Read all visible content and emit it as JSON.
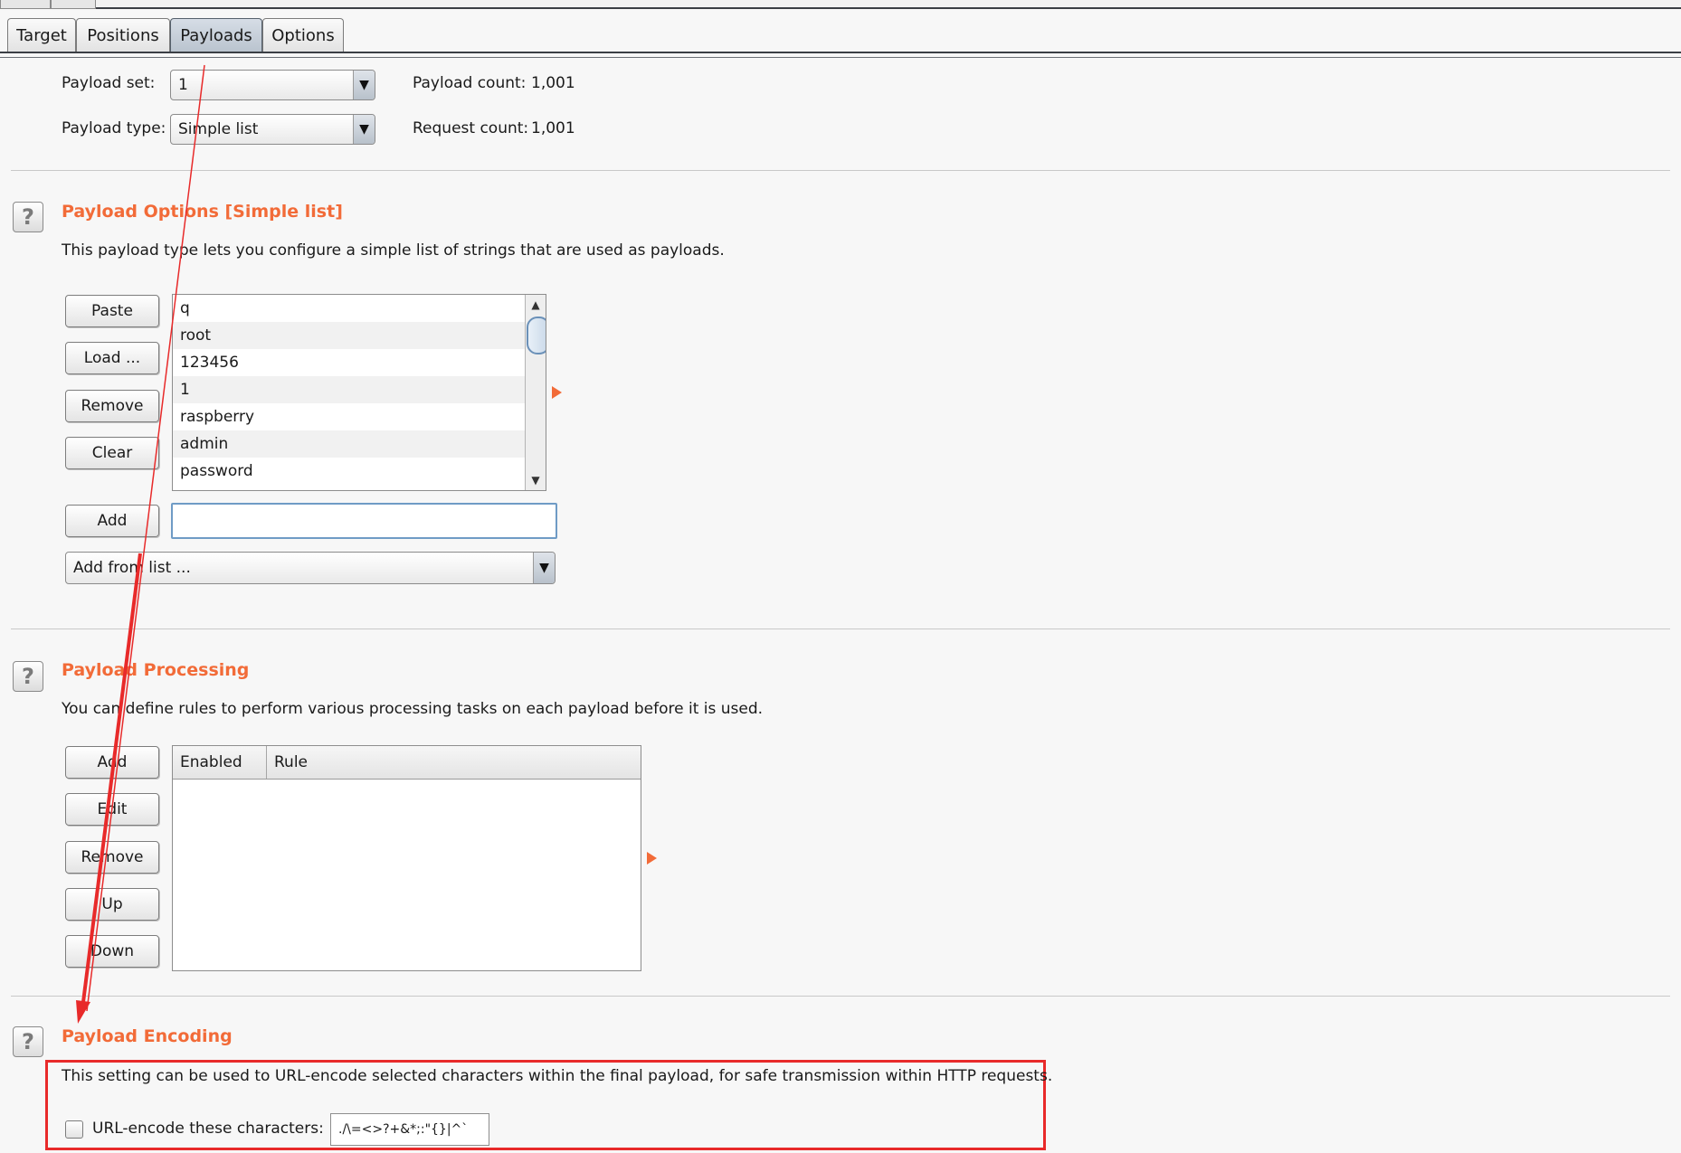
{
  "tabs": [
    {
      "label": "Target"
    },
    {
      "label": "Positions"
    },
    {
      "label": "Payloads",
      "active": true
    },
    {
      "label": "Options"
    }
  ],
  "payload_set": {
    "label": "Payload set:",
    "value": "1"
  },
  "payload_type": {
    "label": "Payload type:",
    "value": "Simple list"
  },
  "payload_count": {
    "label": "Payload count:",
    "value": "1,001"
  },
  "request_count": {
    "label": "Request count:",
    "value": "1,001"
  },
  "options_section": {
    "title": "Payload Options [Simple list]",
    "description": "This payload type lets you configure a simple list of strings that are used as payloads.",
    "buttons": {
      "paste": "Paste",
      "load": "Load ...",
      "remove": "Remove",
      "clear": "Clear",
      "add": "Add"
    },
    "items": [
      "q",
      "root",
      "123456",
      "1",
      "raspberry",
      "admin",
      "password"
    ],
    "add_input_value": "",
    "add_from_list": "Add from list ..."
  },
  "processing_section": {
    "title": "Payload Processing",
    "description": "You can define rules to perform various processing tasks on each payload before it is used.",
    "buttons": {
      "add": "Add",
      "edit": "Edit",
      "remove": "Remove",
      "up": "Up",
      "down": "Down"
    },
    "columns": [
      "Enabled",
      "Rule"
    ]
  },
  "encoding_section": {
    "title": "Payload Encoding",
    "description": "This setting can be used to URL-encode selected characters within the final payload, for safe transmission within HTTP requests.",
    "checkbox_label": "URL-encode these characters:",
    "checked": false,
    "characters": "./\\=<>?+&*;:\"{}|^`"
  },
  "colors": {
    "section_title": "#f26b38",
    "annotation": "#e82a2a",
    "active_tab": "#c4ccd6"
  },
  "icons": {
    "help": "question-mark-icon",
    "combo_arrow": "triangle-down-icon",
    "expand_arrow": "triangle-right-icon"
  }
}
